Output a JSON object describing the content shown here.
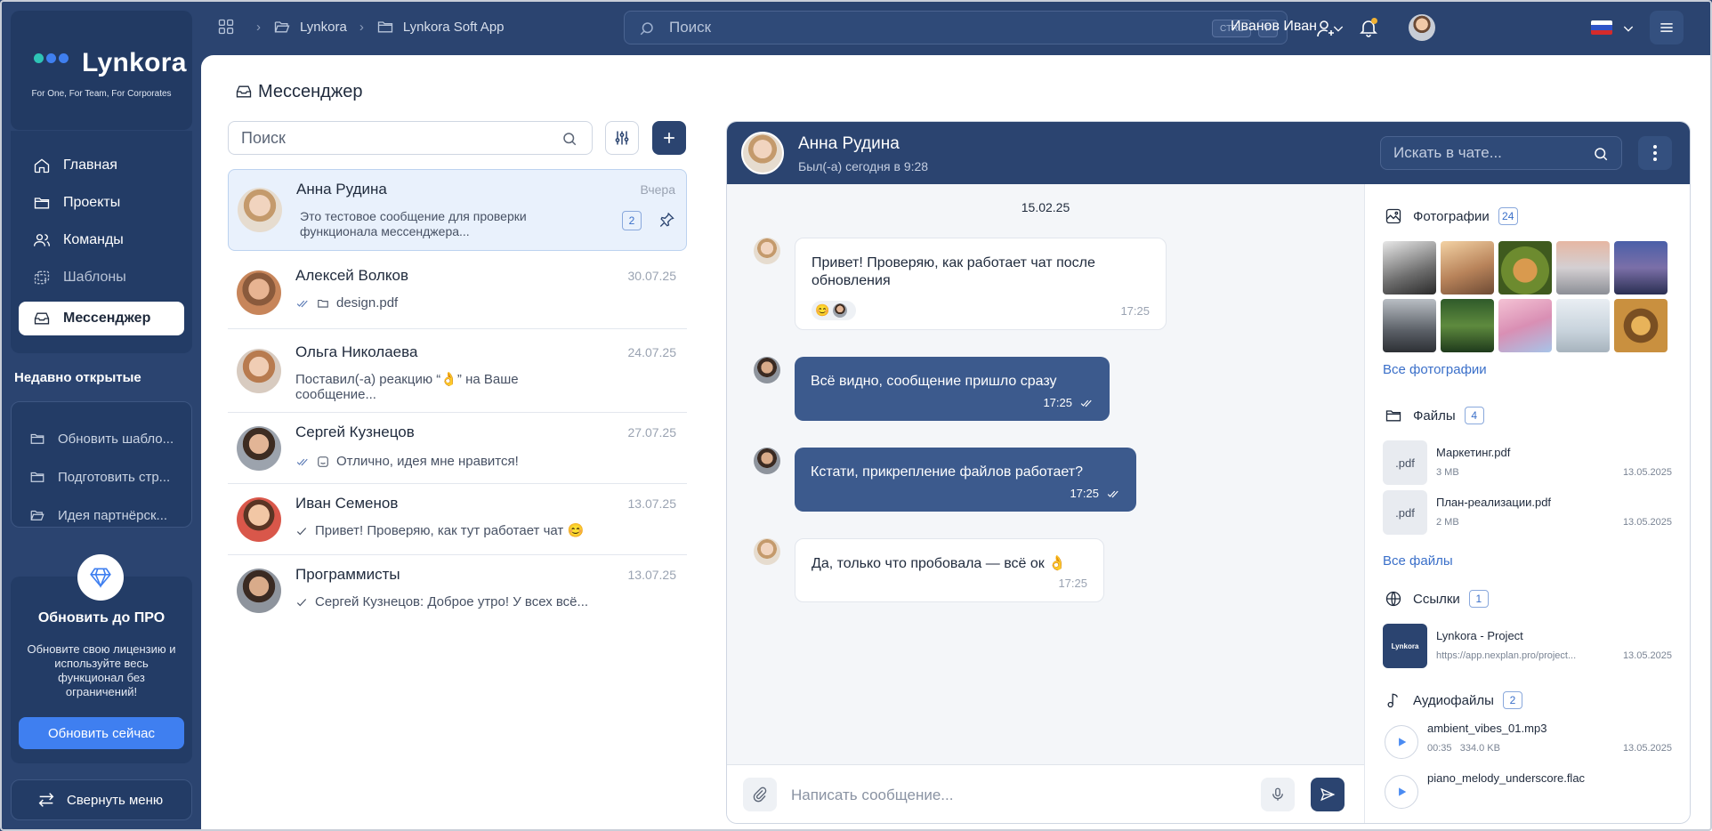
{
  "app": {
    "brand": "Lynkora",
    "tagline": "For One, For Team, For Corporates"
  },
  "colors": {
    "sidebar": "#2b4470",
    "accent": "#3f7ff0",
    "bubble_out": "#3c5a8d",
    "link": "#3a6fc9"
  },
  "sidebar": {
    "items": [
      {
        "label": "Главная",
        "icon": "home-icon"
      },
      {
        "label": "Проекты",
        "icon": "folder-icon"
      },
      {
        "label": "Команды",
        "icon": "users-icon"
      },
      {
        "label": "Шаблоны",
        "icon": "templates-icon"
      },
      {
        "label": "Мессенджер",
        "icon": "inbox-icon",
        "active": true
      }
    ],
    "recent_title": "Недавно открытые",
    "recent": [
      "Обновить шабло...",
      "Подготовить стр...",
      "Идея партнёрск..."
    ],
    "promo": {
      "title": "Обновить до ПРО",
      "text": "Обновите свою лицензию и используйте весь функционал без ограничений!",
      "button": "Обновить сейчас"
    },
    "collapse": "Свернуть меню"
  },
  "topbar": {
    "breadcrumbs": [
      "Lynkora",
      "Lynkora Soft App"
    ],
    "search_placeholder": "Поиск",
    "kbd": [
      "CTRL",
      "F"
    ],
    "user_name": "Иванов Иван",
    "language": "RU"
  },
  "page": {
    "title": "Мессенджер",
    "search_placeholder": "Поиск"
  },
  "chats": [
    {
      "name": "Анна Рудина",
      "date": "Вчера",
      "preview": "Это тестовое сообщение для проверки функционала мессенджера...",
      "unread": "2",
      "active": true
    },
    {
      "name": "Алексей Волков",
      "date": "30.07.25",
      "preview": "design.pdf"
    },
    {
      "name": "Ольга Николаева",
      "date": "24.07.25",
      "preview": "Поставил(-а) реакцию “👌” на Ваше сообщение..."
    },
    {
      "name": "Сергей Кузнецов",
      "date": "27.07.25",
      "preview": "Отлично, идея мне нравится!"
    },
    {
      "name": "Иван Семенов",
      "date": "13.07.25",
      "preview": "Привет! Проверяю, как тут работает чат 😊"
    },
    {
      "name": "Программисты",
      "date": "13.07.25",
      "preview": "Сергей Кузнецов: Доброе утро! У всех всё..."
    }
  ],
  "conversation": {
    "name": "Анна Рудина",
    "status": "Был(-а) сегодня в 9:28",
    "search_placeholder": "Искать в чате...",
    "date": "15.02.25",
    "messages": [
      {
        "text": "Привет! Проверяю, как работает чат после обновления",
        "time": "17:25",
        "dir": "in",
        "reaction": "😊"
      },
      {
        "text": "Всё видно, сообщение пришло сразу",
        "time": "17:25",
        "dir": "out"
      },
      {
        "text": "Кстати, прикрепление файлов работает?",
        "time": "17:25",
        "dir": "out"
      },
      {
        "text": "Да, только что пробовала — всё ок 👌",
        "time": "17:25",
        "dir": "in"
      }
    ],
    "composer_placeholder": "Написать сообщение..."
  },
  "details": {
    "photos": {
      "title": "Фотографии",
      "count": "24",
      "link": "Все фотографии"
    },
    "files": {
      "title": "Файлы",
      "count": "4",
      "link": "Все файлы",
      "items": [
        {
          "ext": ".pdf",
          "name": "Маркетинг.pdf",
          "size": "3 МВ",
          "date": "13.05.2025"
        },
        {
          "ext": ".pdf",
          "name": "План-реализации.pdf",
          "size": "2 МВ",
          "date": "13.05.2025"
        }
      ]
    },
    "links": {
      "title": "Ссылки",
      "count": "1",
      "items": [
        {
          "thumb": "Lynkora",
          "name": "Lynkora - Project",
          "url": "https://app.nexplan.pro/project...",
          "date": "13.05.2025"
        }
      ]
    },
    "audio": {
      "title": "Аудиофайлы",
      "count": "2",
      "items": [
        {
          "name": "ambient_vibes_01.mp3",
          "duration": "00:35",
          "size": "334.0 KB",
          "date": "13.05.2025"
        },
        {
          "name": "piano_melody_underscore.flac"
        }
      ]
    }
  }
}
